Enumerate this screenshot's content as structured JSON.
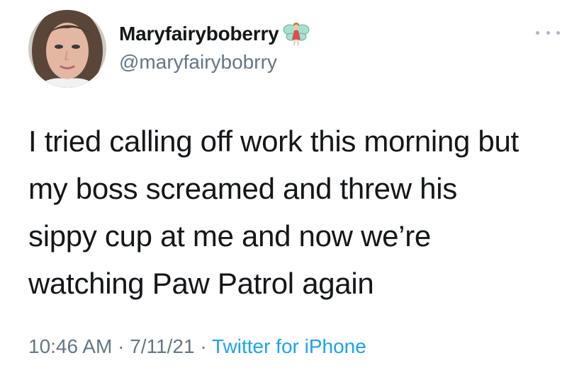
{
  "user": {
    "display_name": "Maryfairyboberry",
    "handle": "@maryfairybobrry",
    "name_emoji": "fairy-icon"
  },
  "tweet": {
    "lines": [
      "I tried calling off work this morning but",
      "my boss screamed and threw his",
      "sippy cup at me and now we’re",
      "watching Paw Patrol again"
    ]
  },
  "meta": {
    "time": "10:46 AM",
    "separator": " · ",
    "date": "7/11/21",
    "source": "Twitter for iPhone"
  },
  "colors": {
    "text": "#14171a",
    "secondary": "#657786",
    "link": "#1da1f2"
  }
}
